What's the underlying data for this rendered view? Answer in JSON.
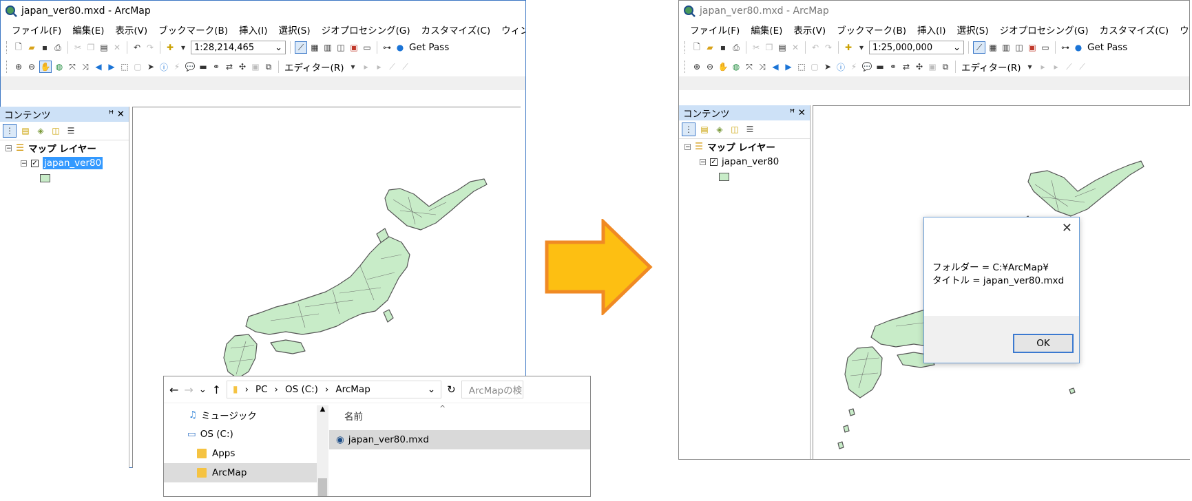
{
  "left_window": {
    "title": "japan_ver80.mxd - ArcMap",
    "menu": [
      "ファイル(F)",
      "編集(E)",
      "表示(V)",
      "ブックマーク(B)",
      "挿入(I)",
      "選択(S)",
      "ジオプロセシング(G)",
      "カスタマイズ(C)",
      "ウィンドウ(W)"
    ],
    "scale": "1:28,214,465",
    "get_pass": "Get Pass",
    "editor": "エディター(R)",
    "contents_title": "コンテンツ",
    "pin": "ꟸ ✕",
    "map_layers": "マップ レイヤー",
    "layer": "japan_ver80"
  },
  "right_window": {
    "title": "japan_ver80.mxd - ArcMap",
    "menu": [
      "ファイル(F)",
      "編集(E)",
      "表示(V)",
      "ブックマーク(B)",
      "挿入(I)",
      "選択(S)",
      "ジオプロセシング(G)",
      "カスタマイズ(C)",
      "ウィンドウ(W)"
    ],
    "scale": "1:25,000,000",
    "get_pass": "Get Pass",
    "editor": "エディター(R)",
    "contents_title": "コンテンツ",
    "map_layers": "マップ レイヤー",
    "layer": "japan_ver80"
  },
  "explorer": {
    "path": [
      "PC",
      "OS (C:)",
      "ArcMap"
    ],
    "search_placeholder": "ArcMapの検索",
    "column_name": "名前",
    "nav_items": [
      "ミュージック",
      "OS (C:)",
      "Apps",
      "ArcMap"
    ],
    "file": "japan_ver80.mxd"
  },
  "dialog": {
    "line1": "フォルダー = C:¥ArcMap¥",
    "line2": "タイトル = japan_ver80.mxd",
    "ok": "OK"
  },
  "colors": {
    "arrow_fill": "#fdbf12",
    "arrow_stroke": "#f08a24",
    "map_fill": "#c8ecc8",
    "map_border": "#555555",
    "selection": "#3399ff"
  }
}
